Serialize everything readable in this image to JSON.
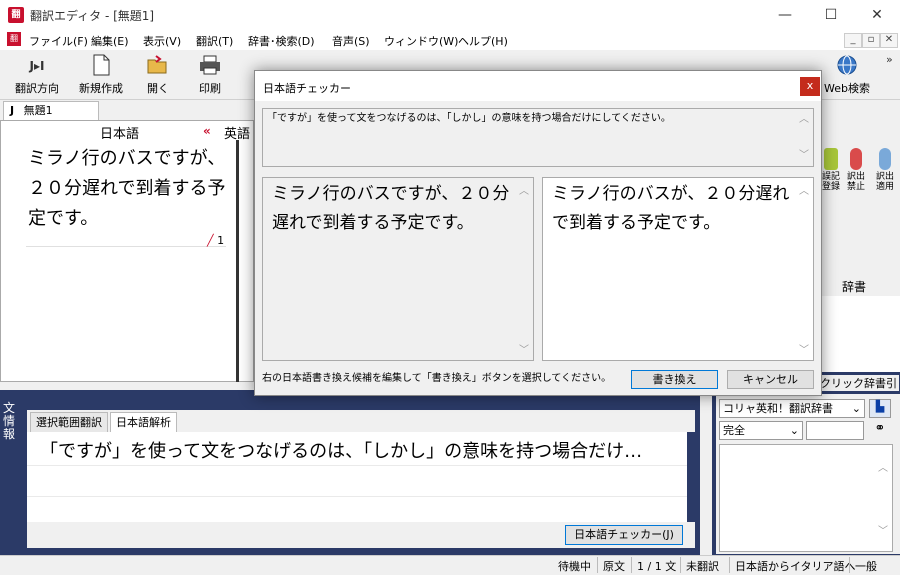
{
  "window": {
    "title": "翻訳エディタ - [無題1]",
    "app_icon": "翻",
    "minimize": "—",
    "maximize": "☐",
    "close": "✕"
  },
  "menu": {
    "items": [
      "ファイル(F)",
      "編集(E)",
      "表示(V)",
      "翻訳(T)",
      "辞書･検索(D)",
      "音声(S)",
      "ウィンドウ(W)",
      "ヘルプ(H)"
    ],
    "mdi_minimize": "_",
    "mdi_restore": "▫",
    "mdi_close": "✕"
  },
  "toolbar": {
    "direction_label": "翻訳方向",
    "direction_icon": "J▸I",
    "new_label": "新規作成",
    "open_label": "開く",
    "print_label": "印刷",
    "web_search_label": "Web検索",
    "overflow": "»"
  },
  "document": {
    "tab_label": "無題1",
    "tab_prefix": "J",
    "source_language": "日本語",
    "target_language": "英語",
    "direction_arrow": "«",
    "source_text": "ミラノ行のバスですが、２０分遅れで到着する予定です。",
    "sentence_marker": "1"
  },
  "side_tools": {
    "item1": "誤記\n登録",
    "item2": "訳出\n禁止",
    "item3": "訳出\n適用",
    "dict_column": "辞書"
  },
  "bottom_panel": {
    "vertical_label": "文情報",
    "tab_selection": "選択範囲翻訳",
    "tab_analysis": "日本語解析",
    "analysis_text": "「ですが」を使って文をつなげるのは、「しかし」の意味を持つ場合だけ…",
    "checker_button": "日本語チェッカー(J)"
  },
  "dictionary_panel": {
    "title": "クリック辞書引",
    "dictionary": "コリャ英和！翻訳辞書",
    "match_mode": "完全",
    "search_value": ""
  },
  "statusbar": {
    "mode": "待機中",
    "view": "原文",
    "count": "1 / 1 文",
    "state": "未翻訳",
    "direction": "日本語からイタリア語へ",
    "field": "一般"
  },
  "dialog": {
    "title": "日本語チェッカー",
    "close": "x",
    "message": "「ですが」を使って文をつなげるのは、「しかし」の意味を持つ場合だけにしてください。",
    "original_text": "ミラノ行のバスですが、２０分遅れで到着する予定です。",
    "rewrite_text": "ミラノ行のバスが、２０分遅れで到着する予定です。",
    "hint": "右の日本語書き換え候補を編集して「書き換え」ボタンを選択してください。",
    "rewrite_button": "書き換え",
    "cancel_button": "キャンセル"
  }
}
